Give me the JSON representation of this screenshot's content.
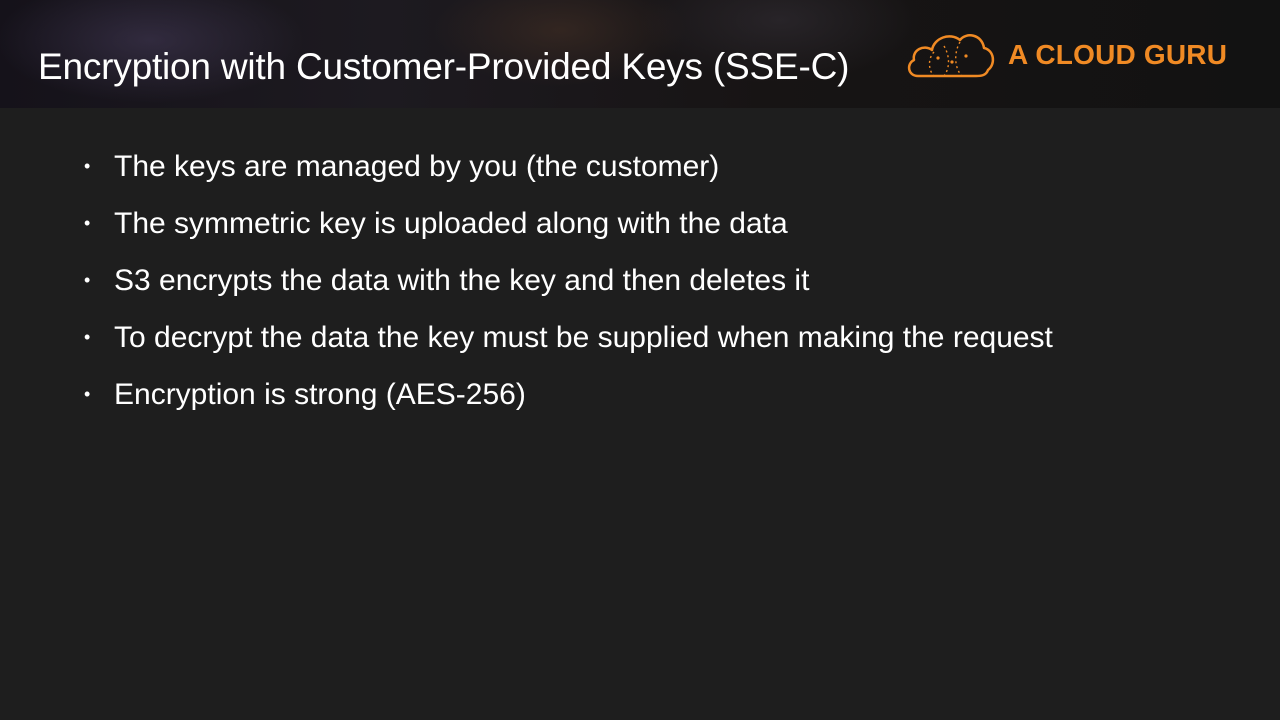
{
  "slide": {
    "title": "Encryption with Customer-Provided Keys (SSE-C)",
    "logo": {
      "text": "A CLOUD GURU",
      "icon": "cloud-icon",
      "color": "#f08a24"
    },
    "bullets": [
      "The keys are managed by you (the customer)",
      "The symmetric key is uploaded along with the data",
      "S3 encrypts the data with the key and then deletes it",
      "To decrypt the data the key must be supplied when making the request",
      "Encryption is strong (AES-256)"
    ],
    "colors": {
      "background": "#1e1e1e",
      "text": "#ffffff",
      "accent": "#f08a24"
    }
  }
}
